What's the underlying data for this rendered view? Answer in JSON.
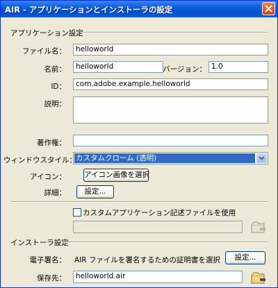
{
  "window": {
    "title": "AIR - アプリケーションとインストーラの設定"
  },
  "app_settings": {
    "section_title": "アプリケーション設定",
    "file_name_label": "ファイル名：",
    "file_name_value": "helloworld",
    "name_label": "名前：",
    "name_value": "helloworld",
    "version_label": "バージョン：",
    "version_value": "1.0",
    "id_label": "ID：",
    "id_value": "com.adobe.example.helloworld",
    "description_label": "説明：",
    "description_value": "",
    "copyright_label": "著作権：",
    "copyright_value": "",
    "window_style_label": "ウィンドウスタイル：",
    "window_style_value": "カスタムクローム (透明)",
    "icon_label": "アイコン：",
    "icon_button": "アイコン画像を選択",
    "advanced_label": "詳細：",
    "advanced_button": "設定..."
  },
  "custom_descriptor": {
    "checkbox_label": "カスタムアプリケーション記述ファイルを使用",
    "checked": false,
    "path_value": ""
  },
  "installer_settings": {
    "section_title": "インストーラ設定",
    "signature_label": "電子署名：",
    "signature_text": "AIR ファイルを署名するための証明書を選択",
    "signature_button": "設定...",
    "destination_label": "保存先：",
    "destination_value": "helloworld.air"
  },
  "icons": {
    "close": "close-icon",
    "dropdown": "chevron-down-icon",
    "browse": "folder-browse-icon"
  }
}
